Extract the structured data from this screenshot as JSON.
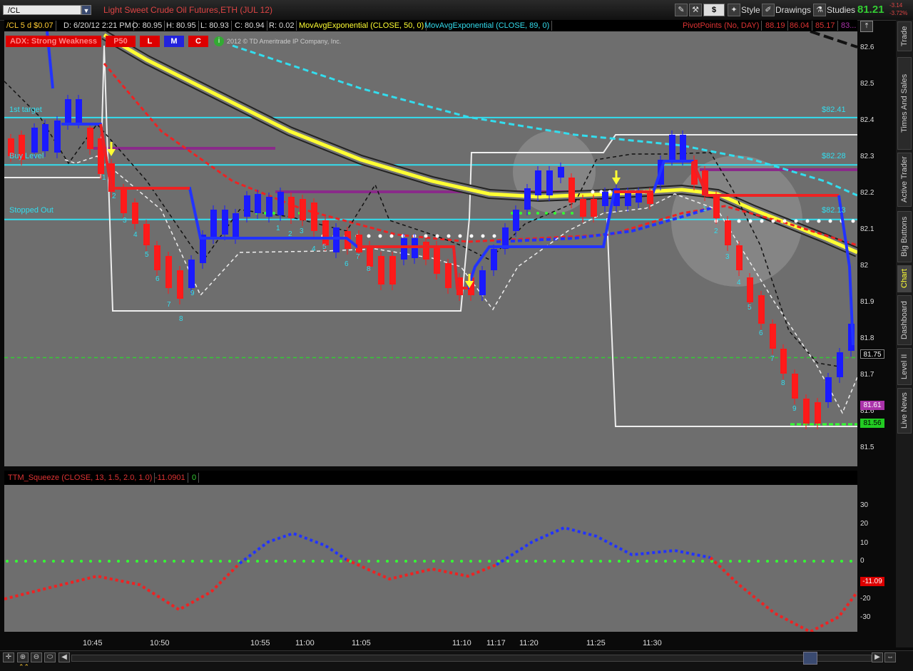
{
  "topbar": {
    "symbol": "/CL",
    "title": "Light Sweet Crude Oil Futures,ETH (JUL 12)",
    "currency_btn": "$",
    "style_label": "Style",
    "drawings_label": "Drawings",
    "studies_label": "Studies",
    "last_price": "81.21",
    "change": "-3.14",
    "change_pct": "-3.72%"
  },
  "infobar": {
    "symbol_period": "/CL 5 d $0.07",
    "date": "D: 6/20/12 2:21 PM",
    "open": "O: 80.95",
    "high": "H: 80.95",
    "low": "L: 80.93",
    "close": "C: 80.94",
    "range": "R: 0.02",
    "study1": "MovAvgExponential (CLOSE, 50, 0)",
    "study2": "MovAvgExponential (CLOSE, 89, 0)",
    "pivot": "PivotPoints (No, DAY)",
    "pv1": "88.19",
    "pv2": "86.04",
    "pv3": "85.17",
    "pv4": "83..."
  },
  "adx": {
    "label": "ADX: Strong Weakness",
    "p": "P50",
    "l": "L",
    "m": "M",
    "c": "C",
    "copyright": "2012 © TD Ameritrade IP Company, Inc."
  },
  "levels": {
    "first_target": "1st target",
    "first_target_val": "$82.41",
    "buy_level": "Buy Level",
    "buy_level_val": "$82.28",
    "stopped_out": "Stopped Out",
    "stopped_out_val": "$82.13"
  },
  "price_axis": [
    "82.6",
    "82.5",
    "82.4",
    "82.3",
    "82.2",
    "82.1",
    "82",
    "81.9",
    "81.8",
    "81.7",
    "81.6",
    "81.5"
  ],
  "price_tags": {
    "t1": "81.75",
    "t2": "81.61",
    "t3": "81.56"
  },
  "lower": {
    "study": "TTM_Squeeze (CLOSE, 13, 1.5, 2.0, 1.0)",
    "value": "-11.0901",
    "zero": "0",
    "axis": [
      "30",
      "20",
      "10",
      "0",
      "-20",
      "-30"
    ],
    "tag": "-11.09"
  },
  "time_axis": [
    "10:45",
    "10:50",
    "10:55",
    "11:00",
    "11:05",
    "11:10",
    "11:17",
    "11:20",
    "11:25",
    "11:30"
  ],
  "counts_left": [
    "1",
    "2",
    "3",
    "4",
    "5",
    "6",
    "7",
    "8",
    "9"
  ],
  "counts_mid": [
    "1",
    "2",
    "3",
    "4",
    "5",
    "6",
    "7",
    "8",
    "9"
  ],
  "counts_right": [
    "1",
    "2",
    "3",
    "4",
    "5",
    "6",
    "7",
    "8",
    "9"
  ],
  "right_tabs": [
    "Trade",
    "Times And Sales",
    "Active Trader",
    "Big Buttons",
    "Chart",
    "Dashboard",
    "Level II",
    "Live News"
  ],
  "colors": {
    "bull": "#1a1aff",
    "bear": "#ff1a1a",
    "ema50": "#ffff33",
    "ema89": "#33ddee",
    "level": "#33ddee",
    "pivot": "#8a2a8a"
  }
}
